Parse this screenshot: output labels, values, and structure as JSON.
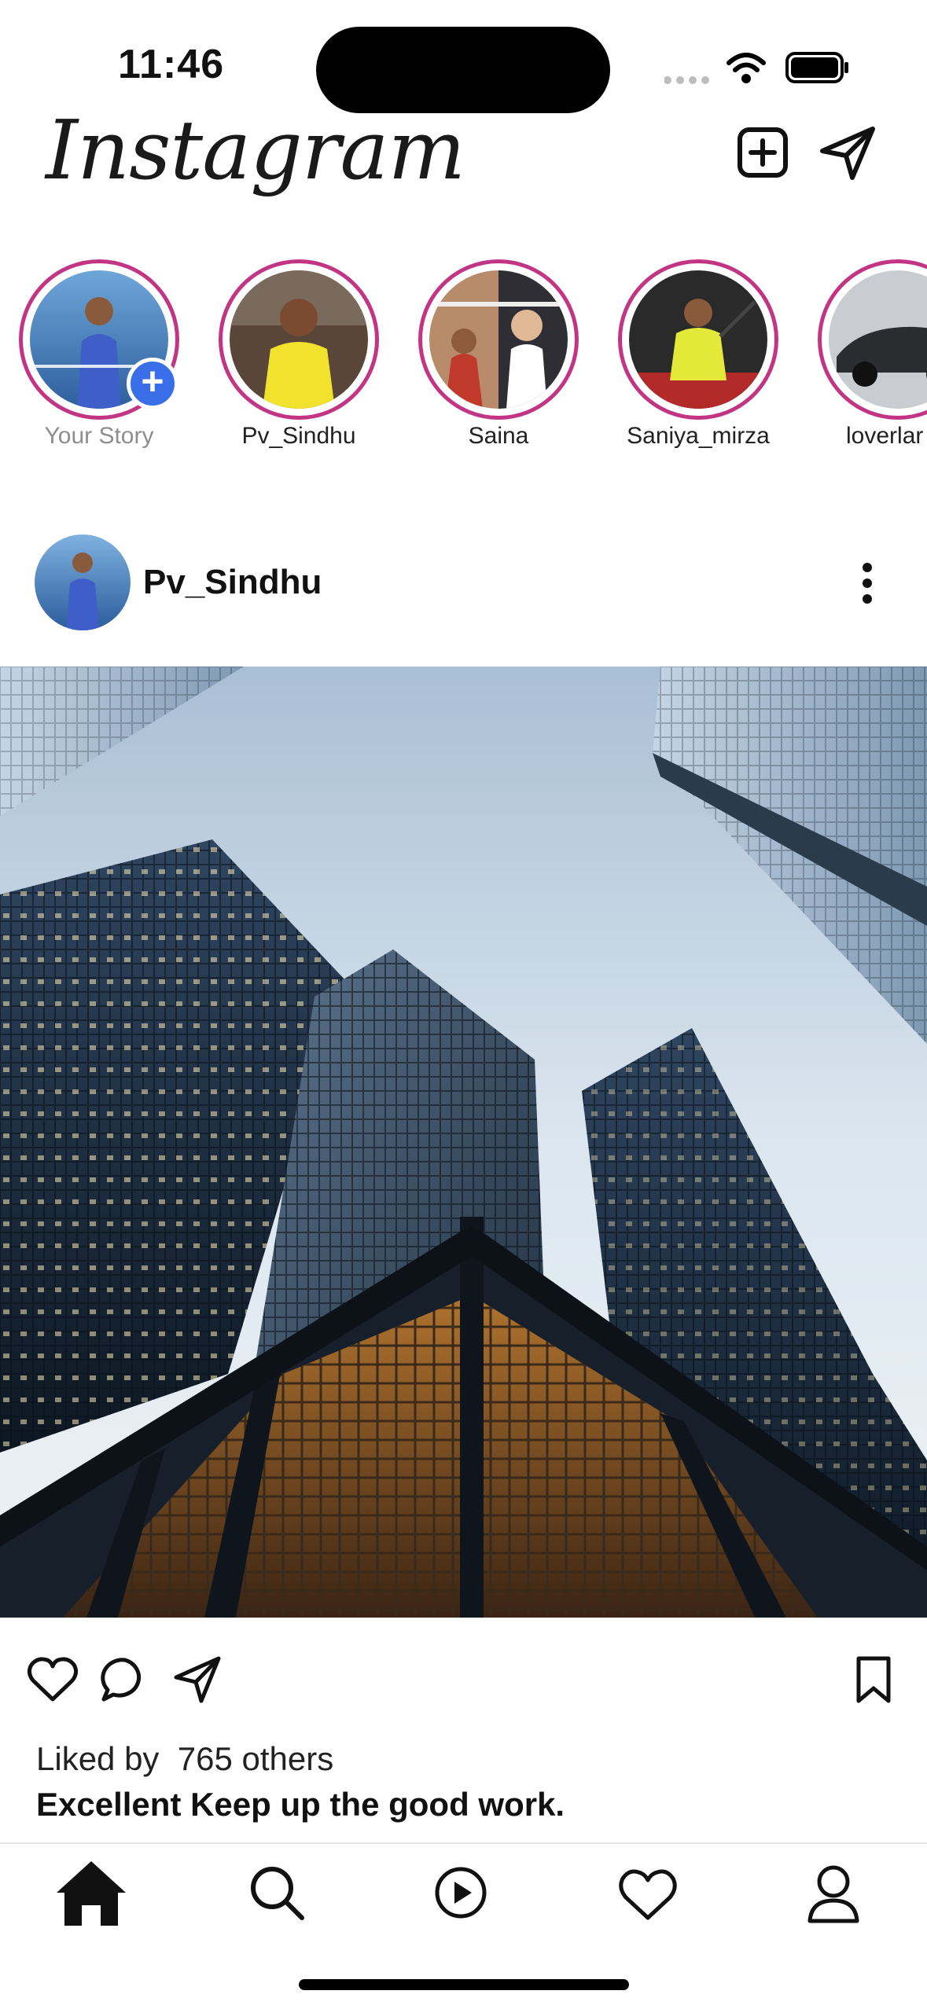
{
  "status_bar": {
    "time": "11:46",
    "icons": [
      "cellular-icon",
      "wifi-icon",
      "battery-icon"
    ]
  },
  "header": {
    "logo_text": "Instagram",
    "icons": [
      "new-post-icon",
      "direct-message-icon"
    ]
  },
  "stories": [
    {
      "label": "Your Story",
      "own": true
    },
    {
      "label": "Pv_Sindhu"
    },
    {
      "label": "Saina"
    },
    {
      "label": "Saniya_mirza"
    },
    {
      "label": "loverlar"
    }
  ],
  "post": {
    "username": "Pv_Sindhu",
    "likes_text": "Liked by  765 others",
    "caption": "Excellent Keep up the good work."
  },
  "actions": [
    "like-icon",
    "comment-icon",
    "share-icon",
    "save-icon"
  ],
  "tab_bar": [
    "home-icon",
    "search-icon",
    "reels-icon",
    "activity-icon",
    "profile-icon"
  ],
  "colors": {
    "story_ring": "#c13584",
    "add_badge": "#3a6ee8"
  }
}
